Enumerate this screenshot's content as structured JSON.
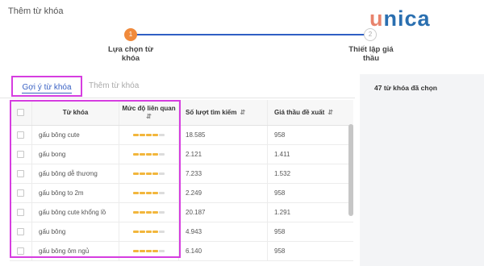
{
  "page": {
    "title": "Thêm từ khóa"
  },
  "logo": {
    "text_u": "u",
    "text_rest": "nica"
  },
  "stepper": {
    "steps": [
      {
        "number": "1",
        "label": "Lựa chọn từ khóa"
      },
      {
        "number": "2",
        "label": "Thiết lập giá thầu"
      }
    ]
  },
  "tabs": {
    "suggest": "Gợi ý từ khóa",
    "entered": "Thêm từ khóa"
  },
  "table": {
    "headers": {
      "keyword": "Từ khóa",
      "relevance": "Mức độ liên quan",
      "relevance_sort": "⇵",
      "searches": "Số lượt tìm kiếm",
      "searches_sort": "⇵",
      "bid": "Giá thầu đề xuất",
      "bid_sort": "⇵"
    },
    "rows": [
      {
        "keyword": "gấu bông cute",
        "relevance": 4,
        "searches": "18.585",
        "bid": "958"
      },
      {
        "keyword": "gấu bong",
        "relevance": 4,
        "searches": "2.121",
        "bid": "1.411"
      },
      {
        "keyword": "gấu bông dễ thương",
        "relevance": 4,
        "searches": "7.233",
        "bid": "1.532"
      },
      {
        "keyword": "gấu bông to 2m",
        "relevance": 4,
        "searches": "2.249",
        "bid": "958"
      },
      {
        "keyword": "gấu bông cute khổng lồ",
        "relevance": 4,
        "searches": "20.187",
        "bid": "1.291"
      },
      {
        "keyword": "gấu bông",
        "relevance": 4,
        "searches": "4.943",
        "bid": "958"
      },
      {
        "keyword": "gấu bông ôm ngủ",
        "relevance": 4,
        "searches": "6.140",
        "bid": "958"
      }
    ],
    "relevance_max": 5
  },
  "right_panel": {
    "selected_count": "47 từ khóa đã chọn"
  },
  "colors": {
    "accent": "#2f5fc4",
    "step_active": "#f08a3c",
    "relevance_bar": "#f2b63c",
    "highlight": "#d63de0"
  }
}
